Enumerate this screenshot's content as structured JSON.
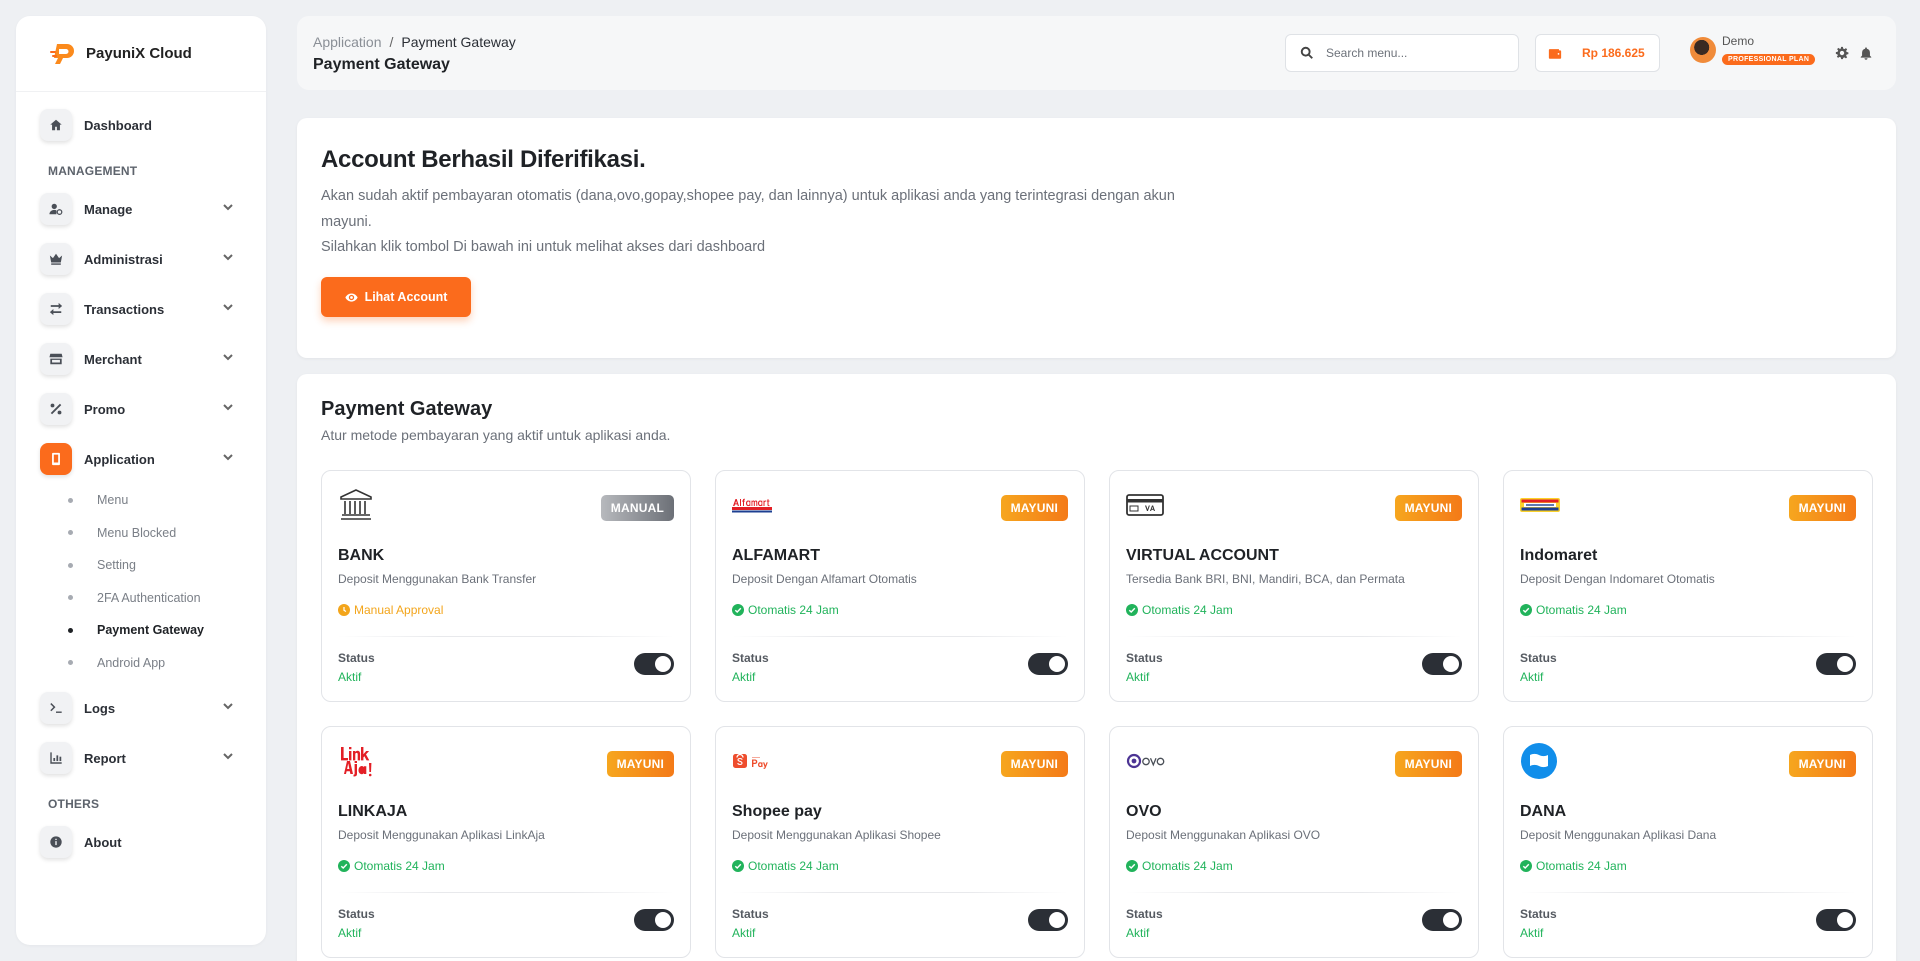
{
  "brand": {
    "name": "PayuniX Cloud",
    "accent": "#fb6b1c"
  },
  "sidebar": {
    "dashboard": "Dashboard",
    "section_management": "MANAGEMENT",
    "items": [
      {
        "label": "Manage",
        "icon": "user-gear-icon"
      },
      {
        "label": "Administrasi",
        "icon": "crown-icon"
      },
      {
        "label": "Transactions",
        "icon": "arrows-swap-icon"
      },
      {
        "label": "Merchant",
        "icon": "store-icon"
      },
      {
        "label": "Promo",
        "icon": "percent-icon"
      },
      {
        "label": "Application",
        "icon": "mobile-icon"
      },
      {
        "label": "Logs",
        "icon": "terminal-icon"
      },
      {
        "label": "Report",
        "icon": "chart-icon"
      }
    ],
    "application_sub": [
      "Menu",
      "Menu Blocked",
      "Setting",
      "2FA Authentication",
      "Payment Gateway",
      "Android App"
    ],
    "section_others": "OTHERS",
    "about": "About"
  },
  "header": {
    "breadcrumb_root": "Application",
    "breadcrumb_sep": "/",
    "breadcrumb_current": "Payment Gateway",
    "title": "Payment Gateway",
    "search_placeholder": "Search menu...",
    "balance": "Rp 186.625",
    "user_name": "Demo",
    "plan": "PROFESSIONAL PLAN"
  },
  "verify": {
    "title": "Account Berhasil Diferifikasi.",
    "line1": "Akan sudah aktif pembayaran otomatis (dana,ovo,gopay,shopee pay, dan lainnya) untuk aplikasi anda yang terintegrasi dengan akun mayuni.",
    "line2": "Silahkan klik tombol Di bawah ini untuk melihat akses dari dashboard",
    "button": "Lihat Account"
  },
  "gateway": {
    "title": "Payment Gateway",
    "subtitle": "Atur metode pembayaran yang aktif untuk aplikasi anda.",
    "status_label": "Status",
    "status_value": "Aktif",
    "cards": [
      {
        "name": "BANK",
        "desc": "Deposit Menggunakan Bank Transfer",
        "badge": "MANUAL",
        "mode": "Manual Approval",
        "logo": "bank-icon"
      },
      {
        "name": "ALFAMART",
        "desc": "Deposit Dengan Alfamart Otomatis",
        "badge": "MAYUNI",
        "mode": "Otomatis 24 Jam",
        "logo": "alfamart-logo"
      },
      {
        "name": "VIRTUAL ACCOUNT",
        "desc": "Tersedia Bank BRI, BNI, Mandiri, BCA, dan Permata",
        "badge": "MAYUNI",
        "mode": "Otomatis 24 Jam",
        "logo": "va-card-logo"
      },
      {
        "name": "Indomaret",
        "desc": "Deposit Dengan Indomaret Otomatis",
        "badge": "MAYUNI",
        "mode": "Otomatis 24 Jam",
        "logo": "indomaret-logo"
      },
      {
        "name": "LINKAJA",
        "desc": "Deposit Menggunakan Aplikasi LinkAja",
        "badge": "MAYUNI",
        "mode": "Otomatis 24 Jam",
        "logo": "linkaja-logo"
      },
      {
        "name": "Shopee pay",
        "desc": "Deposit Menggunakan Aplikasi Shopee",
        "badge": "MAYUNI",
        "mode": "Otomatis 24 Jam",
        "logo": "shopeepay-logo"
      },
      {
        "name": "OVO",
        "desc": "Deposit Menggunakan Aplikasi OVO",
        "badge": "MAYUNI",
        "mode": "Otomatis 24 Jam",
        "logo": "ovo-logo"
      },
      {
        "name": "DANA",
        "desc": "Deposit Menggunakan Aplikasi Dana",
        "badge": "MAYUNI",
        "mode": "Otomatis 24 Jam",
        "logo": "dana-logo"
      }
    ]
  }
}
